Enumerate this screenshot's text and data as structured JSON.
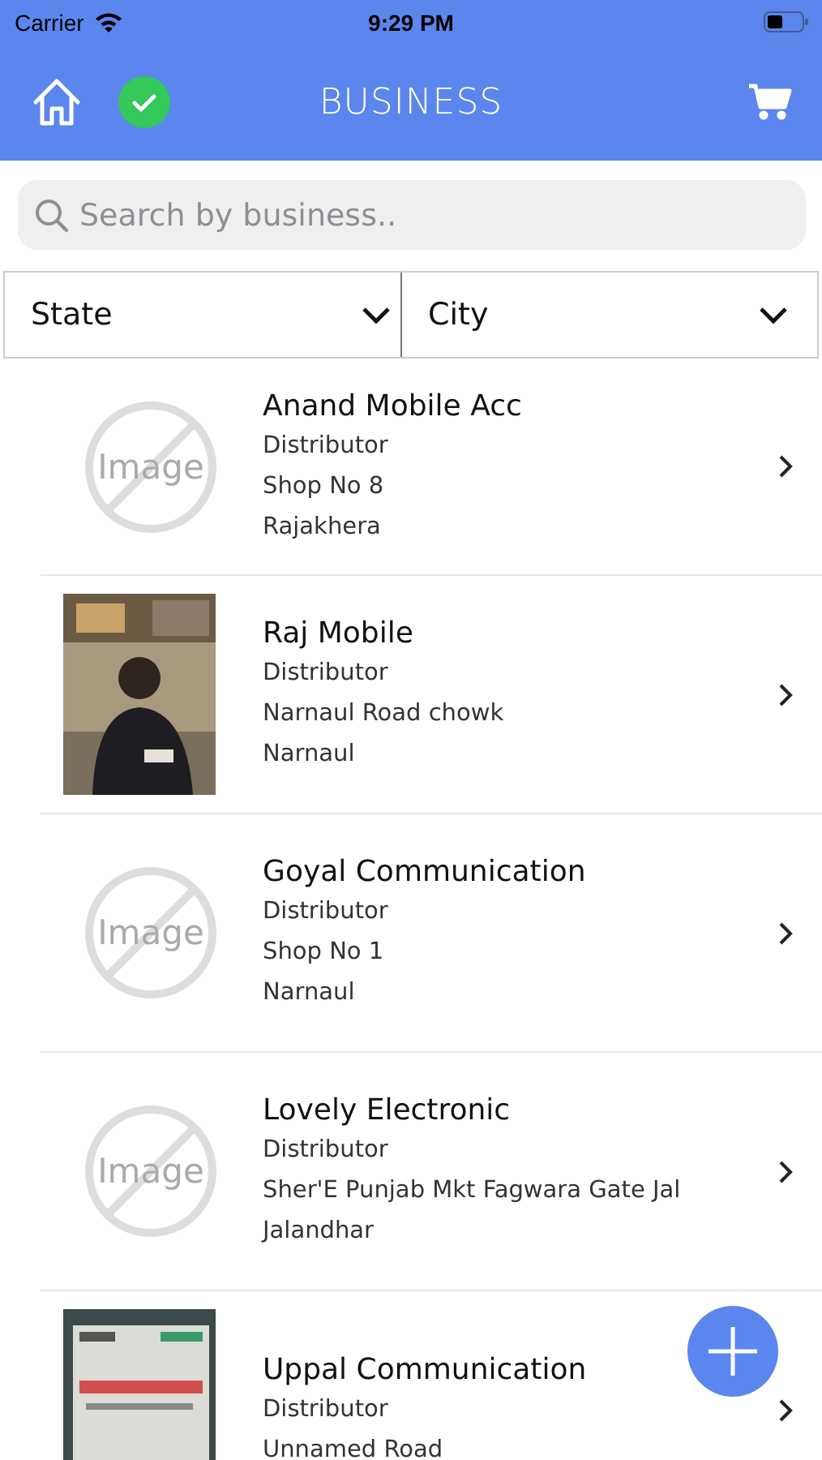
{
  "status_bar": {
    "carrier": "Carrier",
    "time": "9:29 PM"
  },
  "nav_bar": {
    "title": "BUSINESS",
    "verified": true
  },
  "search": {
    "placeholder": "Search by business.."
  },
  "filters": [
    {
      "label": "State"
    },
    {
      "label": "City"
    }
  ],
  "businesses": [
    {
      "name": "Anand Mobile Acc",
      "type": "Distributor",
      "address": "Shop No 8",
      "city": "Rajakhera",
      "image": {
        "kind": "placeholder",
        "label": "Image"
      }
    },
    {
      "name": "Raj Mobile",
      "type": "Distributor",
      "address": "Narnaul Road chowk",
      "city": "Narnaul"
    },
    {
      "name": "Goyal Communication",
      "type": "Distributor",
      "address": "Shop No 1",
      "city": "Narnaul",
      "image": {
        "kind": "placeholder",
        "label": "Image"
      }
    },
    {
      "name": "Lovely Electronic",
      "type": "Distributor",
      "address": "Sher'E Punjab Mkt Fagwara Gate Jal",
      "city": "Jalandhar",
      "image": {
        "kind": "placeholder",
        "label": "Image"
      }
    },
    {
      "name": "Uppal Communication",
      "type": "Distributor",
      "address": "Unnamed Road"
    }
  ]
}
